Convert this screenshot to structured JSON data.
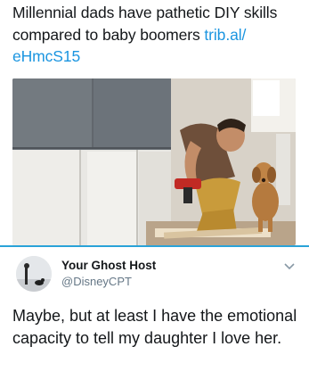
{
  "tweet": {
    "text": "Millennial dads have pathetic DIY skills compared to baby boomers",
    "link_part1": "trib.al/",
    "link_part2": "eHmcS15"
  },
  "photo": {
    "icon": "photo-man-drilling-with-dog"
  },
  "reply": {
    "display_name": "Your Ghost Host",
    "handle": "@DisneyCPT",
    "text": "Maybe, but at least I have the emotional capacity to tell my daughter I love her."
  },
  "colors": {
    "link": "#1b95e0",
    "divider": "#2aa3d8",
    "handle": "#657786",
    "text": "#14171a"
  }
}
